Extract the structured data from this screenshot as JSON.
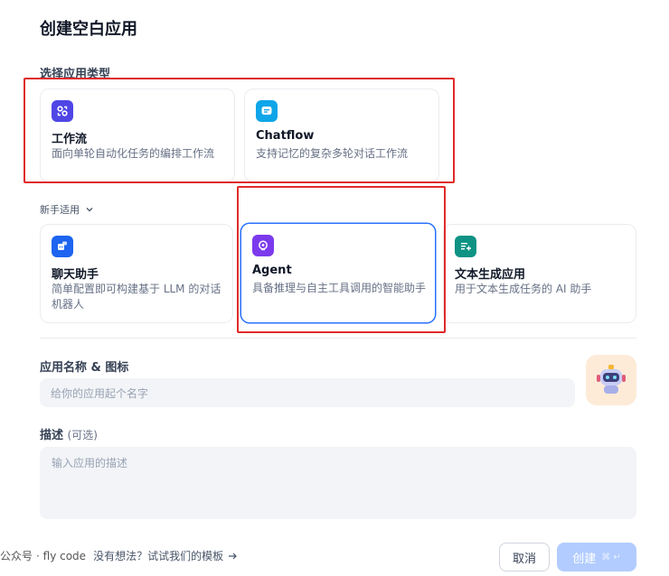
{
  "title": "创建空白应用",
  "type_section_label": "选择应用类型",
  "newbie_label": "新手适用",
  "app_types": [
    {
      "title": "工作流",
      "desc": "面向单轮自动化任务的编排工作流",
      "icon": "workflow-icon",
      "color": "#4f46e5"
    },
    {
      "title": "Chatflow",
      "desc": "支持记忆的复杂多轮对话工作流",
      "icon": "chatflow-icon",
      "color": "#0ea5e9"
    }
  ],
  "beginner_types": [
    {
      "title": "聊天助手",
      "desc": "简单配置即可构建基于 LLM 的对话机器人",
      "icon": "chat-assistant-icon",
      "color": "#1d64f0"
    },
    {
      "title": "Agent",
      "desc": "具备推理与自主工具调用的智能助手",
      "icon": "agent-icon",
      "color": "#7c3aed",
      "selected": true
    },
    {
      "title": "文本生成应用",
      "desc": "用于文本生成任务的 AI 助手",
      "icon": "text-generation-icon",
      "color": "#0e9384"
    }
  ],
  "name_label": "应用名称 & 图标",
  "name_placeholder": "给你的应用起个名字",
  "desc_label": "描述",
  "desc_optional": "(可选)",
  "desc_placeholder": "输入应用的描述",
  "footer": {
    "watermark": "公众号",
    "watermark_suffix": "· fly code",
    "no_idea": "没有想法？试试我们的模板",
    "cancel": "取消",
    "create": "创建",
    "create_shortcut": "⌘ ↵"
  },
  "app_icon": "robot-icon"
}
